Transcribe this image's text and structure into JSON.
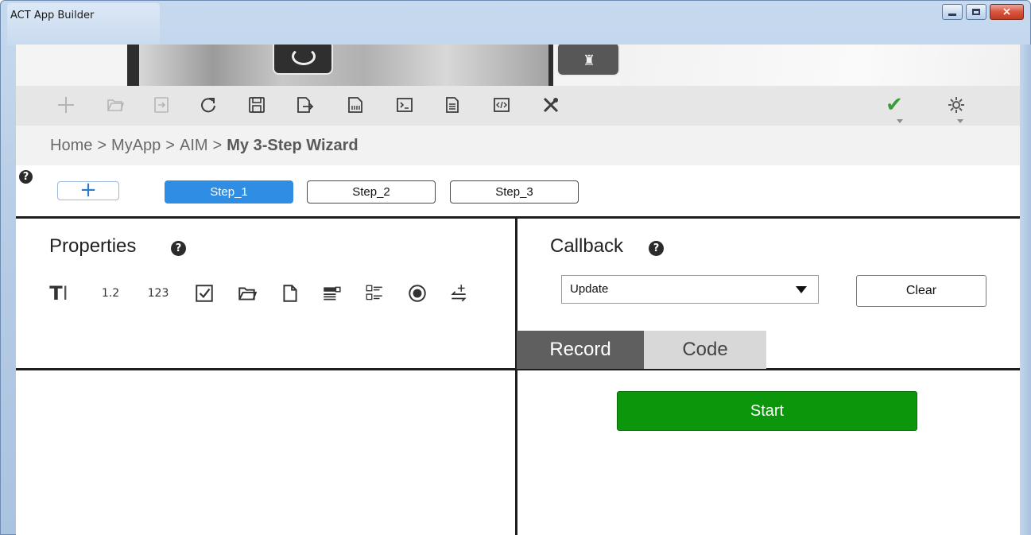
{
  "window": {
    "title": "ACT App Builder",
    "controls": {
      "minimize": "minimize",
      "maximize": "maximize",
      "close": "×"
    }
  },
  "toolbar": {
    "icons": [
      "plus-icon",
      "open-icon",
      "import-icon",
      "redo-icon",
      "save-icon",
      "export-icon",
      "binary-icon",
      "terminal-icon",
      "document-icon",
      "code-icon",
      "tools-icon",
      "check-icon",
      "gear-icon"
    ]
  },
  "breadcrumb": {
    "items": [
      "Home",
      "MyApp",
      "AIM"
    ],
    "separator": ">",
    "current": "My 3-Step Wizard"
  },
  "steps": {
    "add_label": "+",
    "items": [
      {
        "label": "Step_1",
        "active": true
      },
      {
        "label": "Step_2",
        "active": false
      },
      {
        "label": "Step_3",
        "active": false
      }
    ]
  },
  "properties": {
    "title": "Properties",
    "tools": [
      {
        "icon": "text-field-icon",
        "glyph": "TI"
      },
      {
        "icon": "decimal-icon",
        "glyph": "1.2"
      },
      {
        "icon": "integer-icon",
        "glyph": "123"
      },
      {
        "icon": "checkbox-icon",
        "glyph": "☑"
      },
      {
        "icon": "folder-icon",
        "glyph": ""
      },
      {
        "icon": "file-icon",
        "glyph": ""
      },
      {
        "icon": "dropdown-icon",
        "glyph": ""
      },
      {
        "icon": "checklist-icon",
        "glyph": ""
      },
      {
        "icon": "radio-icon",
        "glyph": "◉"
      },
      {
        "icon": "swap-add-icon",
        "glyph": ""
      }
    ]
  },
  "callback": {
    "title": "Callback",
    "selected": "Update",
    "clear_label": "Clear",
    "tabs": [
      {
        "label": "Record",
        "active": true
      },
      {
        "label": "Code",
        "active": false
      }
    ],
    "start_label": "Start"
  },
  "colors": {
    "accent": "#2f8de4",
    "start": "#0c960c",
    "record_tab": "#5f5f5f",
    "code_tab": "#d8d8d8",
    "check": "#3c9c3c"
  }
}
